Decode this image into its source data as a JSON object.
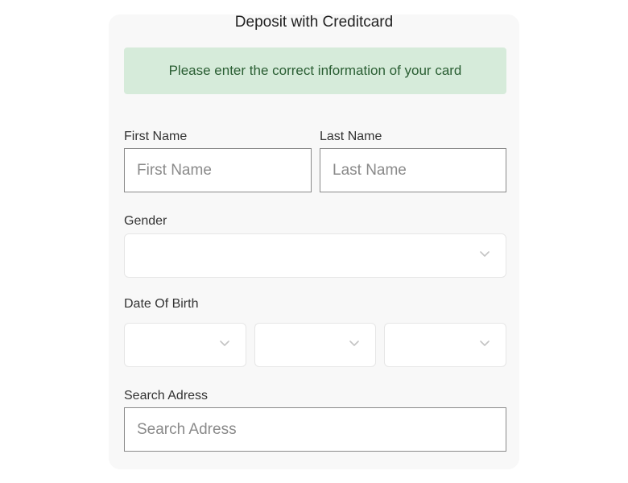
{
  "form": {
    "title": "Deposit with Creditcard",
    "notice": "Please enter the correct information of your card",
    "first_name": {
      "label": "First Name",
      "placeholder": "First Name",
      "value": ""
    },
    "last_name": {
      "label": "Last Name",
      "placeholder": "Last Name",
      "value": ""
    },
    "gender": {
      "label": "Gender",
      "selected": "",
      "icon": "chevron-down-icon"
    },
    "date_of_birth": {
      "label": "Date Of Birth",
      "day": {
        "selected": ""
      },
      "month": {
        "selected": ""
      },
      "year": {
        "selected": ""
      }
    },
    "address": {
      "label": "Search Adress",
      "placeholder": "Search Adress",
      "value": ""
    }
  },
  "colors": {
    "card_background": "#f8f8f8",
    "notice_background": "#d6ebda",
    "notice_text": "#2a5e33",
    "input_border": "#8a8a8a",
    "select_border": "#e6e6e6",
    "chevron": "#c4c4c4"
  }
}
